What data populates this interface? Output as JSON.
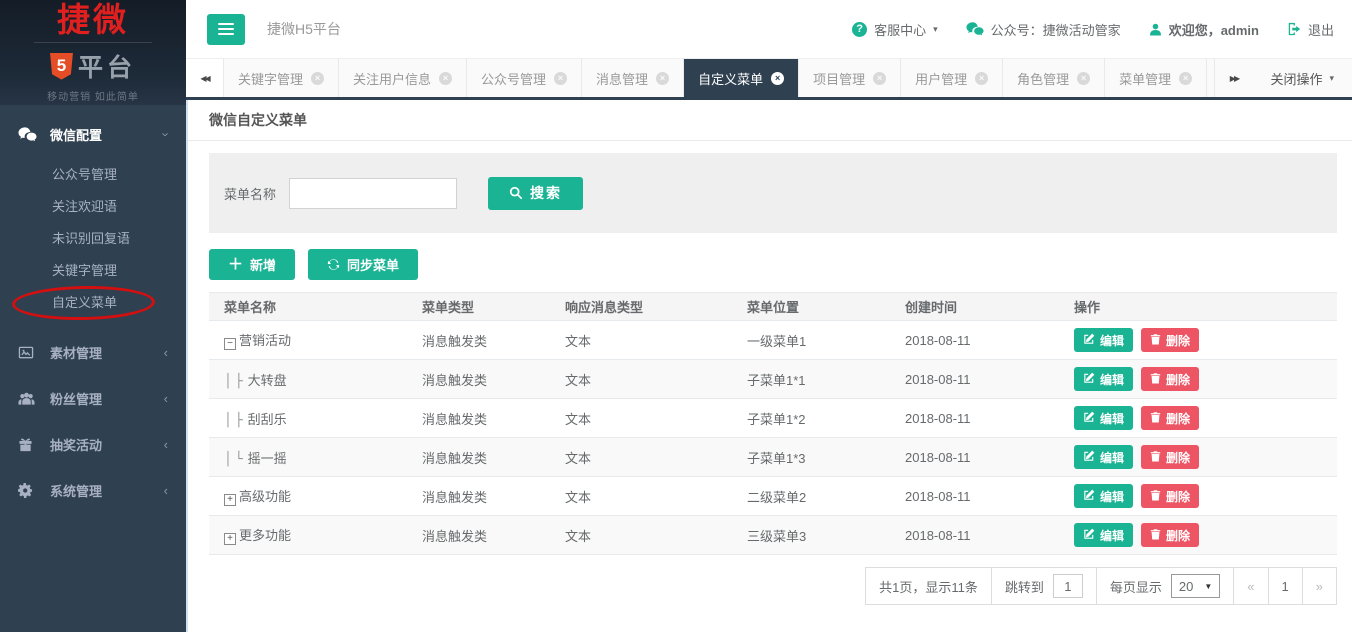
{
  "brand": {
    "name": "捷微",
    "five": "5",
    "platform": "平台",
    "tagline": "移动营销 如此简单"
  },
  "topbar": {
    "app_title": "捷微H5平台",
    "help": "客服中心",
    "account": "公众号：捷微活动管家",
    "welcome": "欢迎您，admin",
    "logout": "退出"
  },
  "tabs": {
    "items": [
      {
        "label": "关键字管理",
        "active": false
      },
      {
        "label": "关注用户信息",
        "active": false
      },
      {
        "label": "公众号管理",
        "active": false
      },
      {
        "label": "消息管理",
        "active": false
      },
      {
        "label": "自定义菜单",
        "active": true
      },
      {
        "label": "项目管理",
        "active": false
      },
      {
        "label": "用户管理",
        "active": false
      },
      {
        "label": "角色管理",
        "active": false
      },
      {
        "label": "菜单管理",
        "active": false
      }
    ],
    "close_ops": "关闭操作"
  },
  "sidebar": {
    "sections": [
      {
        "label": "微信配置",
        "icon": "wechat-icon",
        "expanded": true,
        "children": [
          "公众号管理",
          "关注欢迎语",
          "未识别回复语",
          "关键字管理",
          "自定义菜单"
        ],
        "annotated_child": "自定义菜单"
      },
      {
        "label": "素材管理",
        "icon": "material-icon",
        "expanded": false,
        "children": []
      },
      {
        "label": "粉丝管理",
        "icon": "fans-icon",
        "expanded": false,
        "children": []
      },
      {
        "label": "抽奖活动",
        "icon": "lottery-icon",
        "expanded": false,
        "children": []
      },
      {
        "label": "系统管理",
        "icon": "system-icon",
        "expanded": false,
        "children": []
      }
    ]
  },
  "page": {
    "title": "微信自定义菜单"
  },
  "search": {
    "label": "菜单名称",
    "value": "",
    "button": "搜索"
  },
  "toolbar": {
    "add": "新增",
    "sync": "同步菜单"
  },
  "table": {
    "headers": [
      "菜单名称",
      "菜单类型",
      "响应消息类型",
      "菜单位置",
      "创建时间",
      "操作"
    ],
    "actions": {
      "edit": "编辑",
      "delete": "删除"
    },
    "rows": [
      {
        "tree": "minus",
        "name": "营销活动",
        "type": "消息触发类",
        "response": "文本",
        "position": "一级菜单1",
        "created": "2018-08-11"
      },
      {
        "tree": "branch",
        "name": "大转盘",
        "type": "消息触发类",
        "response": "文本",
        "position": "子菜单1*1",
        "created": "2018-08-11"
      },
      {
        "tree": "branch",
        "name": "刮刮乐",
        "type": "消息触发类",
        "response": "文本",
        "position": "子菜单1*2",
        "created": "2018-08-11"
      },
      {
        "tree": "branch-end",
        "name": "摇一摇",
        "type": "消息触发类",
        "response": "文本",
        "position": "子菜单1*3",
        "created": "2018-08-11"
      },
      {
        "tree": "plus",
        "name": "高级功能",
        "type": "消息触发类",
        "response": "文本",
        "position": "二级菜单2",
        "created": "2018-08-11"
      },
      {
        "tree": "plus",
        "name": "更多功能",
        "type": "消息触发类",
        "response": "文本",
        "position": "三级菜单3",
        "created": "2018-08-11"
      }
    ]
  },
  "pagination": {
    "summary": "共1页，显示11条",
    "jump_label": "跳转到",
    "jump_value": "1",
    "per_page_label": "每页显示",
    "per_page_value": "20",
    "prev": "«",
    "current": "1",
    "next": "»"
  },
  "colors": {
    "primary": "#1ab394",
    "danger": "#ed5565",
    "sidebar": "#2f4050",
    "tab_active": "#2f4050"
  }
}
